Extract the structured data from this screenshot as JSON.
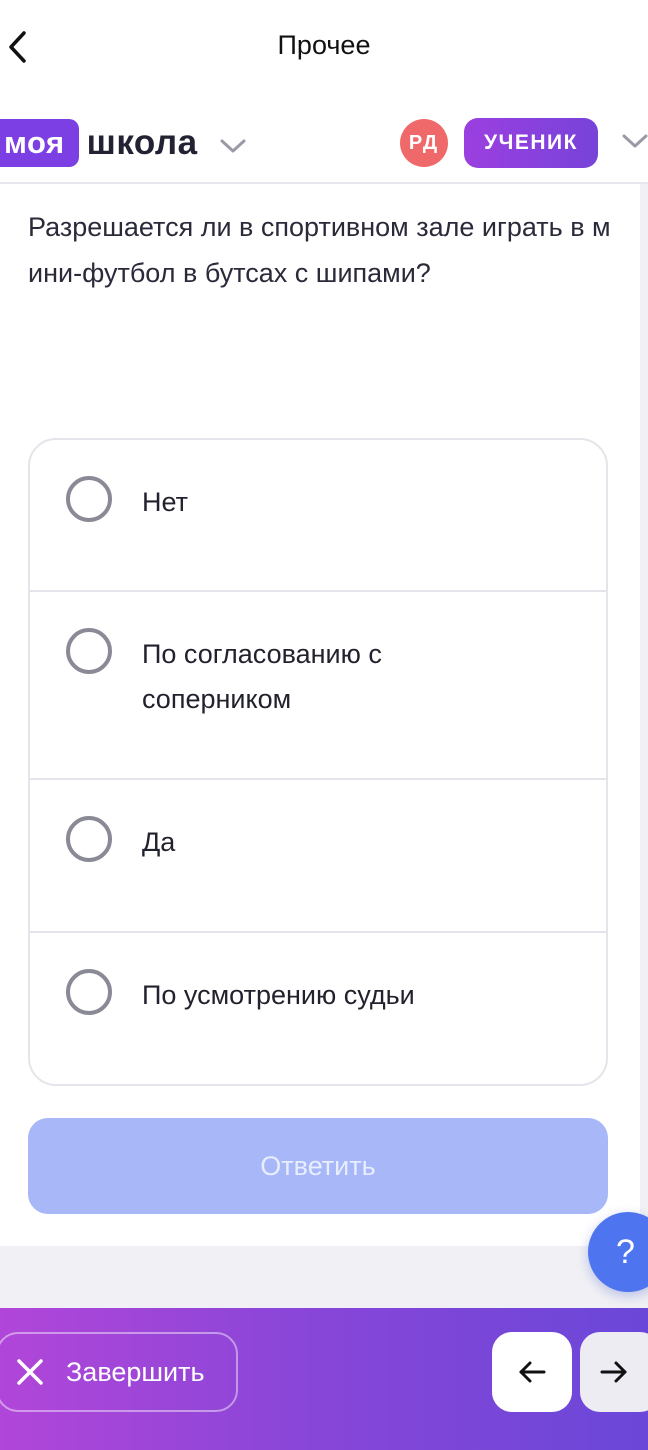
{
  "header": {
    "title": "Прочее",
    "back_icon": "chevron-left-icon"
  },
  "school_bar": {
    "logo_part1": "моя",
    "logo_part2": "школа",
    "avatar_initials": "РД",
    "role": "УЧЕНИК"
  },
  "question": {
    "text": "Разрешается ли в спортивном зале играть в мини-футбол в бутсах с шипами?",
    "options": [
      {
        "label": "Нет"
      },
      {
        "label": "По согласованию с соперником"
      },
      {
        "label": "Да"
      },
      {
        "label": "По усмотрению судьи"
      }
    ],
    "submit_label": "Ответить"
  },
  "help": {
    "label": "?"
  },
  "footer": {
    "finish_label": "Завершить",
    "prev_icon": "arrow-left-icon",
    "next_icon": "arrow-right-icon"
  },
  "colors": {
    "brand_purple": "#7b3fe4",
    "avatar_red": "#f0696a",
    "submit_disabled": "#a7b7f8",
    "help_blue": "#4f74f0",
    "footer_gradient_start": "#b146d9",
    "footer_gradient_end": "#6a47d8"
  }
}
